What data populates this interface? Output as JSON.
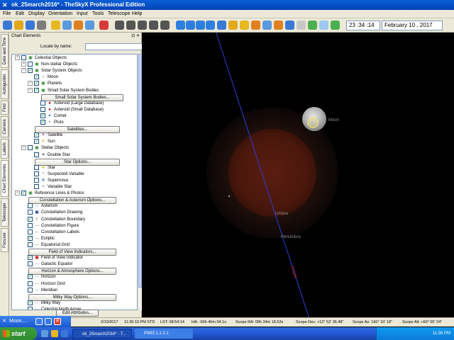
{
  "window": {
    "title": "ok_25march2016* - TheSkyX Professional Edition"
  },
  "menu": [
    "File",
    "Edit",
    "Display",
    "Orientation",
    "Input",
    "Tools",
    "Telescope",
    "Help"
  ],
  "toolbar": {
    "time": "23 :34 :14",
    "date": "February 10 , 2017"
  },
  "side_tabs": [
    "Date and Time",
    "Autoguider",
    "Find",
    "Camera",
    "Labels",
    "Chart Elements",
    "Telescope",
    "Focuser"
  ],
  "panel": {
    "title": "Chart Elements",
    "locate_label": "Locate by name:",
    "locate_value": "",
    "edit_button": "Edit Attributes..."
  },
  "tree": [
    {
      "text": "Celestial Objects",
      "indent": 0,
      "type": "node",
      "checked": false
    },
    {
      "text": "Non-stellar Objects",
      "indent": 1,
      "type": "node",
      "checked": false
    },
    {
      "text": "Solar System Objects",
      "indent": 1,
      "type": "node",
      "checked": true
    },
    {
      "text": "Moon",
      "indent": 2,
      "type": "item",
      "checked": true,
      "icon": "●",
      "color": "#c8c8c8"
    },
    {
      "text": "Planets",
      "indent": 2,
      "type": "node",
      "checked": true
    },
    {
      "text": "Small Solar System Bodies",
      "indent": 2,
      "type": "node",
      "checked": true
    },
    {
      "text": "Small Solar System Bodies...",
      "indent": 3,
      "type": "button"
    },
    {
      "text": "Asteroid (Large Database)",
      "indent": 3,
      "type": "item",
      "checked": false,
      "icon": "●",
      "color": "#c00000"
    },
    {
      "text": "Asteroid (Small Database)",
      "indent": 3,
      "type": "item",
      "checked": false,
      "icon": "●",
      "color": "#c00000"
    },
    {
      "text": "Comet",
      "indent": 3,
      "type": "item",
      "checked": true,
      "icon": "✦",
      "color": "#1a5fd0"
    },
    {
      "text": "Pluto",
      "indent": 3,
      "type": "item",
      "checked": true,
      "icon": "•",
      "color": "#555555"
    },
    {
      "text": "Satellites...",
      "indent": 2,
      "type": "button"
    },
    {
      "text": "Satellite",
      "indent": 2,
      "type": "item",
      "checked": true,
      "icon": "✈",
      "color": "#8b3ba8"
    },
    {
      "text": "Sun",
      "indent": 2,
      "type": "item",
      "checked": true,
      "icon": "☀",
      "color": "#e0a000"
    },
    {
      "text": "Stellar Objects",
      "indent": 1,
      "type": "node",
      "checked": false
    },
    {
      "text": "Double Star",
      "indent": 2,
      "type": "item",
      "checked": false,
      "icon": "✶",
      "color": "#333333"
    },
    {
      "text": "Star Options...",
      "indent": 2,
      "type": "button"
    },
    {
      "text": "Star",
      "indent": 2,
      "type": "item",
      "checked": false,
      "icon": "★",
      "color": "#e0c000"
    },
    {
      "text": "Suspected Variable",
      "indent": 2,
      "type": "item",
      "checked": false,
      "icon": "*",
      "color": "#555555"
    },
    {
      "text": "Supernova",
      "indent": 2,
      "type": "item",
      "checked": false,
      "icon": "✺",
      "color": "#6aa0e0"
    },
    {
      "text": "Variable Star",
      "indent": 2,
      "type": "item",
      "checked": false,
      "icon": "✧",
      "color": "#555555"
    },
    {
      "text": "Reference Lines & Photos",
      "indent": 0,
      "type": "node",
      "checked": true
    },
    {
      "text": "Constellation & Asterism Options...",
      "indent": 1,
      "type": "button"
    },
    {
      "text": "Asterism",
      "indent": 1,
      "type": "item",
      "checked": false,
      "icon": "—",
      "color": "#888888"
    },
    {
      "text": "Constellation Drawing",
      "indent": 1,
      "type": "item",
      "checked": false,
      "icon": "▣",
      "color": "#1a3a8a"
    },
    {
      "text": "Constellation Boundary",
      "indent": 1,
      "type": "item",
      "checked": true,
      "icon": "⌇",
      "color": "#555555"
    },
    {
      "text": "Constellation Figure",
      "indent": 1,
      "type": "item",
      "checked": false,
      "icon": "—",
      "color": "#888888"
    },
    {
      "text": "Constellation Labels",
      "indent": 1,
      "type": "item",
      "checked": false,
      "icon": "—",
      "color": "#888888"
    },
    {
      "text": "Ecliptic",
      "indent": 1,
      "type": "item",
      "checked": true,
      "icon": "—",
      "color": "#888888"
    },
    {
      "text": "Equatorial Grid",
      "indent": 1,
      "type": "item",
      "checked": false,
      "icon": "—",
      "color": "#888888"
    },
    {
      "text": "Field of View Indicators...",
      "indent": 1,
      "type": "button"
    },
    {
      "text": "Field of View Indicator",
      "indent": 1,
      "type": "item",
      "checked": true,
      "icon": "▣",
      "color": "#c00000"
    },
    {
      "text": "Galactic Equator",
      "indent": 1,
      "type": "item",
      "checked": false,
      "icon": "—",
      "color": "#888888"
    },
    {
      "text": "Horizon & Atmosphere Options...",
      "indent": 1,
      "type": "button"
    },
    {
      "text": "Horizon",
      "indent": 1,
      "type": "item",
      "checked": true,
      "icon": "—",
      "color": "#888888"
    },
    {
      "text": "Horizon Grid",
      "indent": 1,
      "type": "item",
      "checked": false,
      "icon": "—",
      "color": "#888888"
    },
    {
      "text": "Meridian",
      "indent": 1,
      "type": "item",
      "checked": false,
      "icon": "—",
      "color": "#888888"
    },
    {
      "text": "Milky Way Options...",
      "indent": 1,
      "type": "button"
    },
    {
      "text": "Milky Way",
      "indent": 1,
      "type": "item",
      "checked": true,
      "icon": "—",
      "color": "#888888"
    },
    {
      "text": "Celestial North Arrow",
      "indent": 1,
      "type": "item",
      "checked": false,
      "icon": "—",
      "color": "#888888"
    }
  ],
  "sky": {
    "moon_label": "Moon",
    "umbra_label": "Umbra",
    "penumbra_label": "Penumbra",
    "ecliptic_label": "Ecliptic"
  },
  "status": {
    "date": "2/10/2017",
    "time": "11:36:10 PM STD",
    "lst": "LST: 08:54:14",
    "ha": "HA: -00h 40m 04.1s",
    "scope_ra": "Scope RA: 09h 34m 18.52s",
    "scope_dec": "Scope Dec: +12° 52' 36.48\"",
    "scope_az": "Scope Az: 160° 10' 18\"",
    "scope_alt": "Scope Alt: +60° 00' 24\""
  },
  "moon_window": {
    "title": "Moon...."
  },
  "taskbar": {
    "start": "start",
    "tasks": [
      "ok_25march2016* - T...",
      "PWI3 1.1.2.1"
    ],
    "clock": "11:36 PM"
  }
}
